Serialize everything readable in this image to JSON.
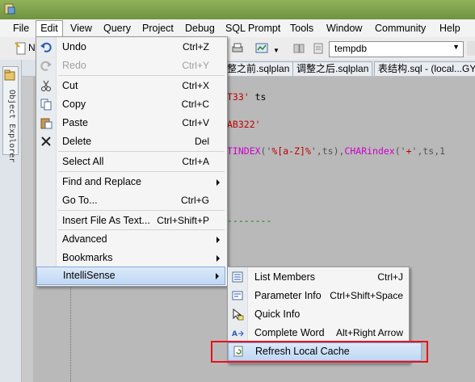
{
  "menubar": {
    "items": [
      "File",
      "Edit",
      "View",
      "Query",
      "Project",
      "Debug",
      "SQL Prompt",
      "Tools",
      "Window",
      "Community",
      "Help"
    ]
  },
  "toolbar": {
    "new_query_label": "N",
    "database": "tempdb"
  },
  "tabs": [
    "整之前.sqlplan",
    "调整之后.sqlplan",
    "表结构.sql - (local...GY"
  ],
  "sidebar": {
    "object_explorer_label": "Object Explorer"
  },
  "editor": {
    "line1_str": "T33'",
    "line1_alias": " ts",
    "line2_str": "AB322'",
    "line3_a": "TINDEX",
    "line3_b": "('",
    "line3_c": "%[a-Z]%",
    "line3_d": "',ts),",
    "line3_e": "CHARindex",
    "line3_f": "('",
    "line3_g": "+",
    "line3_h": "',ts,1",
    "line4_comment": "--------"
  },
  "edit_menu": {
    "undo": {
      "label": "Undo",
      "shortcut": "Ctrl+Z"
    },
    "redo": {
      "label": "Redo",
      "shortcut": "Ctrl+Y"
    },
    "cut": {
      "label": "Cut",
      "shortcut": "Ctrl+X"
    },
    "copy": {
      "label": "Copy",
      "shortcut": "Ctrl+C"
    },
    "paste": {
      "label": "Paste",
      "shortcut": "Ctrl+V"
    },
    "delete": {
      "label": "Delete",
      "shortcut": "Del"
    },
    "select_all": {
      "label": "Select All",
      "shortcut": "Ctrl+A"
    },
    "find_replace": {
      "label": "Find and Replace"
    },
    "goto": {
      "label": "Go To...",
      "shortcut": "Ctrl+G"
    },
    "insert_file": {
      "label": "Insert File As Text...",
      "shortcut": "Ctrl+Shift+P"
    },
    "advanced": {
      "label": "Advanced"
    },
    "bookmarks": {
      "label": "Bookmarks"
    },
    "intellisense": {
      "label": "IntelliSense"
    }
  },
  "intellisense_menu": {
    "list_members": {
      "label": "List Members",
      "shortcut": "Ctrl+J"
    },
    "parameter_info": {
      "label": "Parameter Info",
      "shortcut": "Ctrl+Shift+Space"
    },
    "quick_info": {
      "label": "Quick Info"
    },
    "complete_word": {
      "label": "Complete Word",
      "shortcut": "Alt+Right Arrow"
    },
    "refresh_cache": {
      "label": "Refresh Local Cache"
    }
  },
  "colors": {
    "highlight_border": "#e8101a",
    "menu_selection": "#c0d8f5",
    "editor_background": "#b9b9b9"
  }
}
